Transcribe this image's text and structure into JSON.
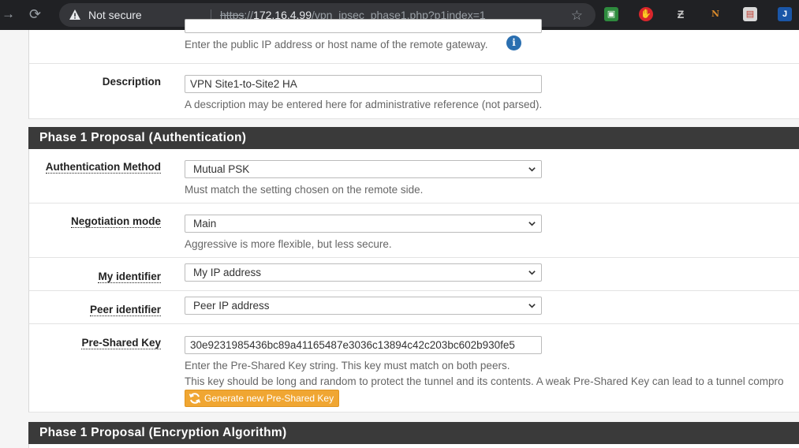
{
  "browser": {
    "security_label": "Not secure",
    "url_scheme": "https",
    "url_host": "172.16.4.99",
    "url_path": "/vpn_ipsec_phase1.php?p1index=1",
    "ext_n_label": "N",
    "ext_j_label": "J"
  },
  "remote_gateway": {
    "help": "Enter the public IP address or host name of the remote gateway."
  },
  "description": {
    "label": "Description",
    "value": "VPN Site1-to-Site2 HA",
    "help": "A description may be entered here for administrative reference (not parsed)."
  },
  "section_auth": {
    "title": "Phase 1 Proposal (Authentication)"
  },
  "auth_method": {
    "label": "Authentication Method",
    "value": "Mutual PSK",
    "help": "Must match the setting chosen on the remote side."
  },
  "negotiation_mode": {
    "label": "Negotiation mode",
    "value": "Main",
    "help": "Aggressive is more flexible, but less secure."
  },
  "my_identifier": {
    "label": "My identifier",
    "value": "My IP address"
  },
  "peer_identifier": {
    "label": "Peer identifier",
    "value": "Peer IP address"
  },
  "psk": {
    "label": "Pre-Shared Key",
    "value": "30e9231985436bc89a41165487e3036c13894c42c203bc602b930fe5",
    "help1": "Enter the Pre-Shared Key string. This key must match on both peers.",
    "help2": "This key should be long and random to protect the tunnel and its contents. A weak Pre-Shared Key can lead to a tunnel compro",
    "generate_label": "Generate new Pre-Shared Key"
  },
  "section_enc": {
    "title": "Phase 1 Proposal (Encryption Algorithm)"
  },
  "colors": {
    "section_bg": "#3a3a3a",
    "button_orange": "#f0a632",
    "info_blue": "#2a6fb0"
  }
}
